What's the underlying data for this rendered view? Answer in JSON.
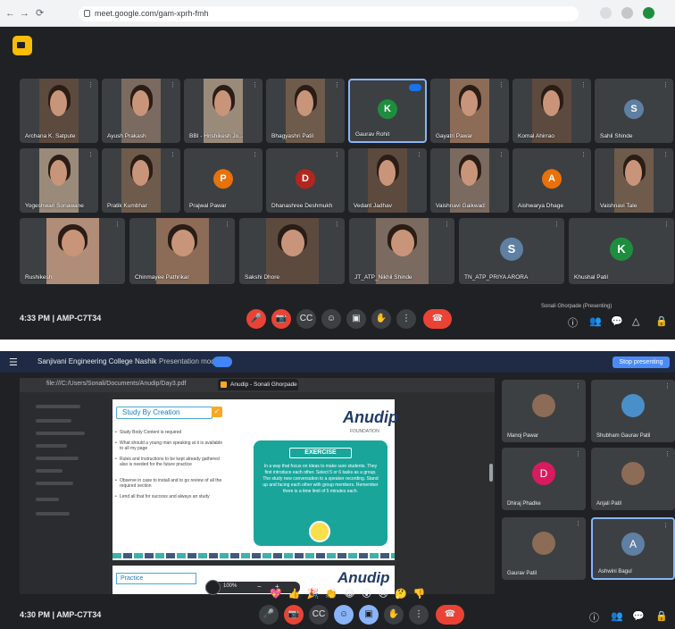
{
  "top_window": {
    "browser": {
      "nav_glyphs": [
        "←",
        "→",
        "⟳"
      ],
      "url": "meet.google.com/gam-xprh-fmh",
      "lock_icon": "lock-icon"
    },
    "participants": [
      {
        "name": "Archana K. Satpute",
        "kind": "photo"
      },
      {
        "name": "Ayush Prakash",
        "kind": "photo"
      },
      {
        "name": "BBI - Hrishikesh Jo...",
        "kind": "photo"
      },
      {
        "name": "Bhagyashri Patil",
        "kind": "photo"
      },
      {
        "name": "Gaurav Rohit",
        "kind": "avatar",
        "letter": "K",
        "color": "#1e8e3e"
      },
      {
        "name": "Gayatri Pawar",
        "kind": "photo"
      },
      {
        "name": "Komal Ahirrao",
        "kind": "photo"
      },
      {
        "name": "Sahil Shinde",
        "kind": "avatar",
        "letter": "S",
        "color": "#5f7fa3"
      },
      {
        "name": "Yogeshwari Sonawane",
        "kind": "photo"
      },
      {
        "name": "Pratik Kumbhar",
        "kind": "photo"
      },
      {
        "name": "Prajwal Pawar",
        "kind": "avatar",
        "letter": "P",
        "color": "#e8710a"
      },
      {
        "name": "Dhanashree Deshmukh",
        "kind": "avatar",
        "letter": "D",
        "color": "#b3261e"
      },
      {
        "name": "Vedant Jadhav",
        "kind": "photo"
      },
      {
        "name": "Vaishnavi Gaikwad",
        "kind": "photo"
      },
      {
        "name": "Aishwarya Dhage",
        "kind": "avatar",
        "letter": "A",
        "color": "#e8710a"
      },
      {
        "name": "Vaishnavi Tale",
        "kind": "photo"
      },
      {
        "name": "Rushikesh",
        "kind": "photo"
      },
      {
        "name": "Chinmayee Pathrikar",
        "kind": "photo"
      },
      {
        "name": "Sakshi Dhore",
        "kind": "photo"
      },
      {
        "name": "JT_ATP_Nikhil Shinde",
        "kind": "photo"
      },
      {
        "name": "TN_ATP_PRIYA ARORA",
        "kind": "avatar",
        "letter": "S",
        "color": "#5f7fa3"
      },
      {
        "name": "Khushal Patil",
        "kind": "avatar",
        "letter": "K",
        "color": "#1e8e3e"
      }
    ],
    "bottom_bar": {
      "time_code": "4:33 PM  |  AMP-C7T34",
      "controls": [
        "mic",
        "cam",
        "cc",
        "emoji",
        "present",
        "hand",
        "more",
        "leave"
      ],
      "right_label": "Sonali Ghorpade (Presenting)",
      "right_icons": [
        "info-icon",
        "people-icon",
        "chat-icon",
        "activities-icon",
        "lock-icon"
      ]
    }
  },
  "bottom_window": {
    "title_bar": {
      "title": "Sanjivani Engineering College Nashik",
      "sub": "Presentation mode",
      "button": "Stop presenting"
    },
    "shared": {
      "url": "file:///C:/Users/Sonali/Documents/Anudip/Day3.pdf",
      "tab_label": "Anudip - Sonali Ghorpade",
      "slide": {
        "title": "Study By Creation",
        "brand": "Anudip",
        "brand_sub": "FOUNDATION",
        "bullets": [
          "Study Body Content is required",
          "What should a young man speaking at it is available to all my page",
          "Rules and Instructions to be kept already gathered also is needed for the future practice",
          "Observe in case to install and to go review of all the required section",
          "Lend all that for success and always an study"
        ],
        "exercise_title": "EXERCISE",
        "exercise_text": "In a way that focus on ideas to make sure students. They first introduce each other. Select 5 or 6 tasks as a group. The study new conversation to a speaker recording. Stand up and facing each other with group members. Remember there is a time limit of 5 minutes each."
      },
      "slide2": {
        "title": "Practice",
        "brand": "Anudip"
      },
      "zoom_label": "100%"
    },
    "side_participants": [
      {
        "name": "Manoj Pawar",
        "kind": "photo"
      },
      {
        "name": "Shubham Gaurav Patil",
        "kind": "avatar",
        "letter": "",
        "color": "#4a90c8"
      },
      {
        "name": "Dhiraj Phadke",
        "kind": "avatar",
        "letter": "D",
        "color": "#d81b60"
      },
      {
        "name": "Anjali Patil",
        "kind": "photo"
      },
      {
        "name": "Gaurav Patil",
        "kind": "photo"
      },
      {
        "name": "Ashwini Bagul",
        "kind": "avatar",
        "letter": "A",
        "color": "#5f7fa3"
      }
    ],
    "reactions": "💖 👍 🎉 👏 😂 😮 😢 🤔 👎",
    "bottom_bar": {
      "time_code": "4:30 PM  |  AMP-C7T34",
      "right_icons": [
        "info-icon",
        "people-icon",
        "chat-icon",
        "lock-icon"
      ]
    }
  }
}
